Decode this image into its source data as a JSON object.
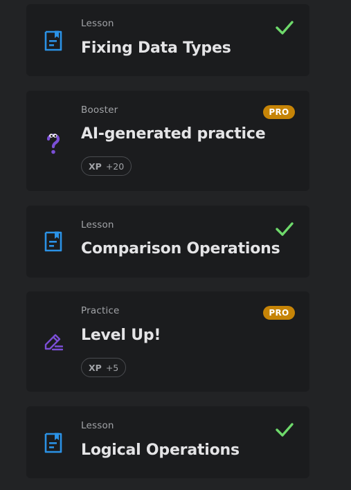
{
  "colors": {
    "page_background": "#222325",
    "card_background": "#1b1c1e",
    "lesson_icon": "#2b92e6",
    "check": "#6ed96b",
    "pro_badge": "#c68407",
    "purple_icon": "#7b4fd6"
  },
  "cards": [
    {
      "type": "Lesson",
      "title": "Fixing Data Types",
      "icon": "lesson-document-icon",
      "status": "completed"
    },
    {
      "type": "Booster",
      "title": "AI-generated practice",
      "icon": "question-mark-icon",
      "badge": "PRO",
      "xp_label": "XP",
      "xp_value": "+20"
    },
    {
      "type": "Lesson",
      "title": "Comparison Operations",
      "icon": "lesson-document-icon",
      "status": "completed"
    },
    {
      "type": "Practice",
      "title": "Level Up!",
      "icon": "pencil-icon",
      "badge": "PRO",
      "xp_label": "XP",
      "xp_value": "+5"
    },
    {
      "type": "Lesson",
      "title": "Logical Operations",
      "icon": "lesson-document-icon",
      "status": "completed"
    }
  ]
}
